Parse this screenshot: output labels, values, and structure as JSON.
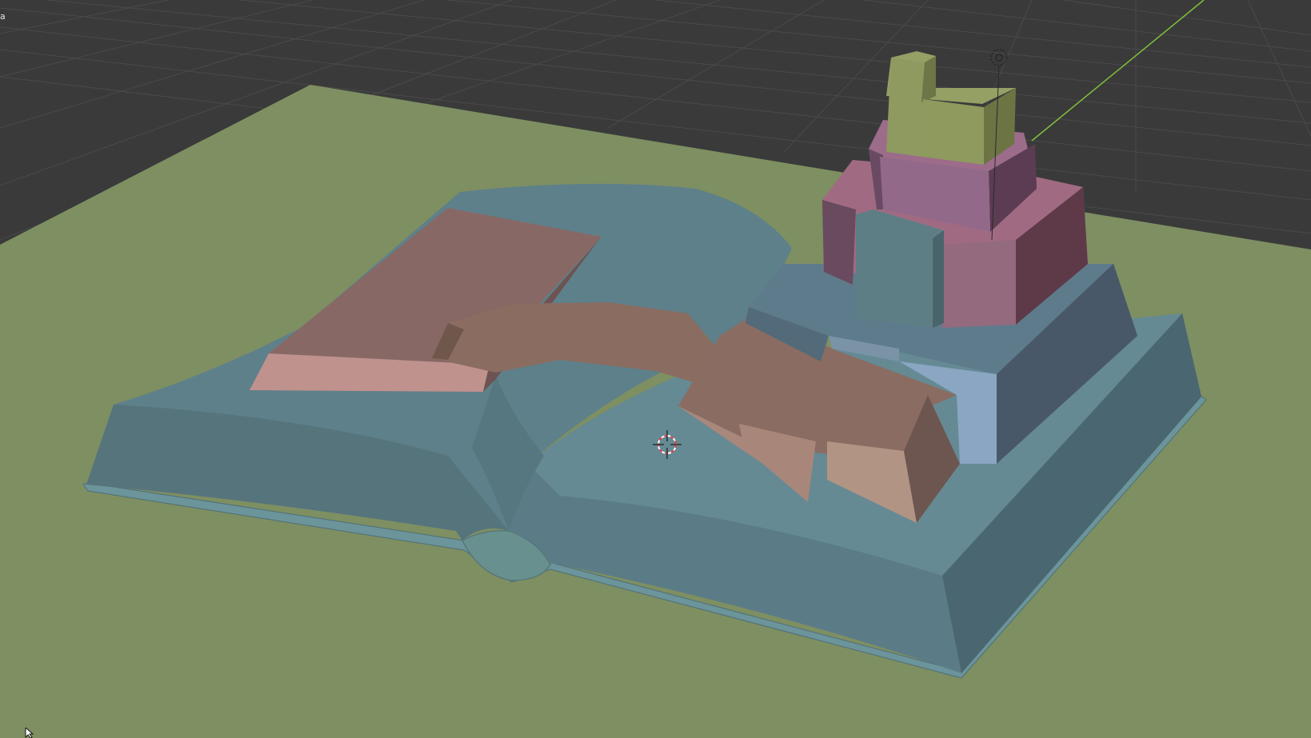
{
  "viewport": {
    "corner_label": "a",
    "colors": {
      "background": "#3a3a3a",
      "grid_line": "#4a4a4a",
      "ground": "#7e8f62",
      "book_cover": "#5e808a",
      "y_axis": "#7fc23a"
    },
    "icons": {
      "cursor_3d": "3d-cursor-icon",
      "light": "light-icon",
      "mouse_pointer": "mouse-pointer-icon"
    }
  }
}
